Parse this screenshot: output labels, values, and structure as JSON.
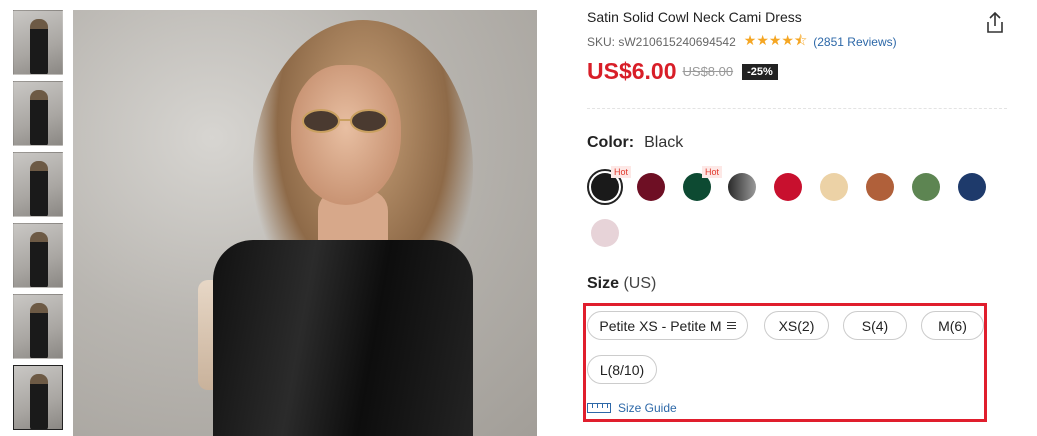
{
  "product": {
    "title": "Satin Solid Cowl Neck Cami Dress",
    "sku": "SKU: sW210615240694542",
    "rating_stars": "★★★★⯪",
    "reviews": "(2851 Reviews)",
    "price": "US$6.00",
    "original_price": "US$8.00",
    "discount": "-25%"
  },
  "color": {
    "label": "Color:",
    "selected_value": "Black",
    "hot_tag": "Hot",
    "swatches": [
      {
        "name": "black",
        "color": "#1a1a1a",
        "hot": true,
        "selected": true
      },
      {
        "name": "burgundy",
        "color": "#6e0f24",
        "hot": false
      },
      {
        "name": "dark-green",
        "color": "#0d4a32",
        "hot": true
      },
      {
        "name": "grey-gradient",
        "color": "#5a5a5a",
        "hot": false
      },
      {
        "name": "red",
        "color": "#c8102e",
        "hot": false
      },
      {
        "name": "champagne",
        "color": "#ecd2a6",
        "hot": false
      },
      {
        "name": "brown",
        "color": "#b0603a",
        "hot": false
      },
      {
        "name": "green",
        "color": "#5d8552",
        "hot": false
      },
      {
        "name": "navy",
        "color": "#1e3a6b",
        "hot": false
      },
      {
        "name": "pink",
        "color": "#e7d3d8",
        "hot": false
      }
    ]
  },
  "size": {
    "label": "Size",
    "unit": "(US)",
    "options": [
      "Petite XS - Petite M",
      "XS(2)",
      "S(4)",
      "M(6)",
      "L(8/10)"
    ],
    "guide_label": "Size Guide"
  },
  "colors": {
    "accent_red": "#d81e28",
    "link_blue": "#2d68a8",
    "highlight_border": "#e01e2d"
  }
}
